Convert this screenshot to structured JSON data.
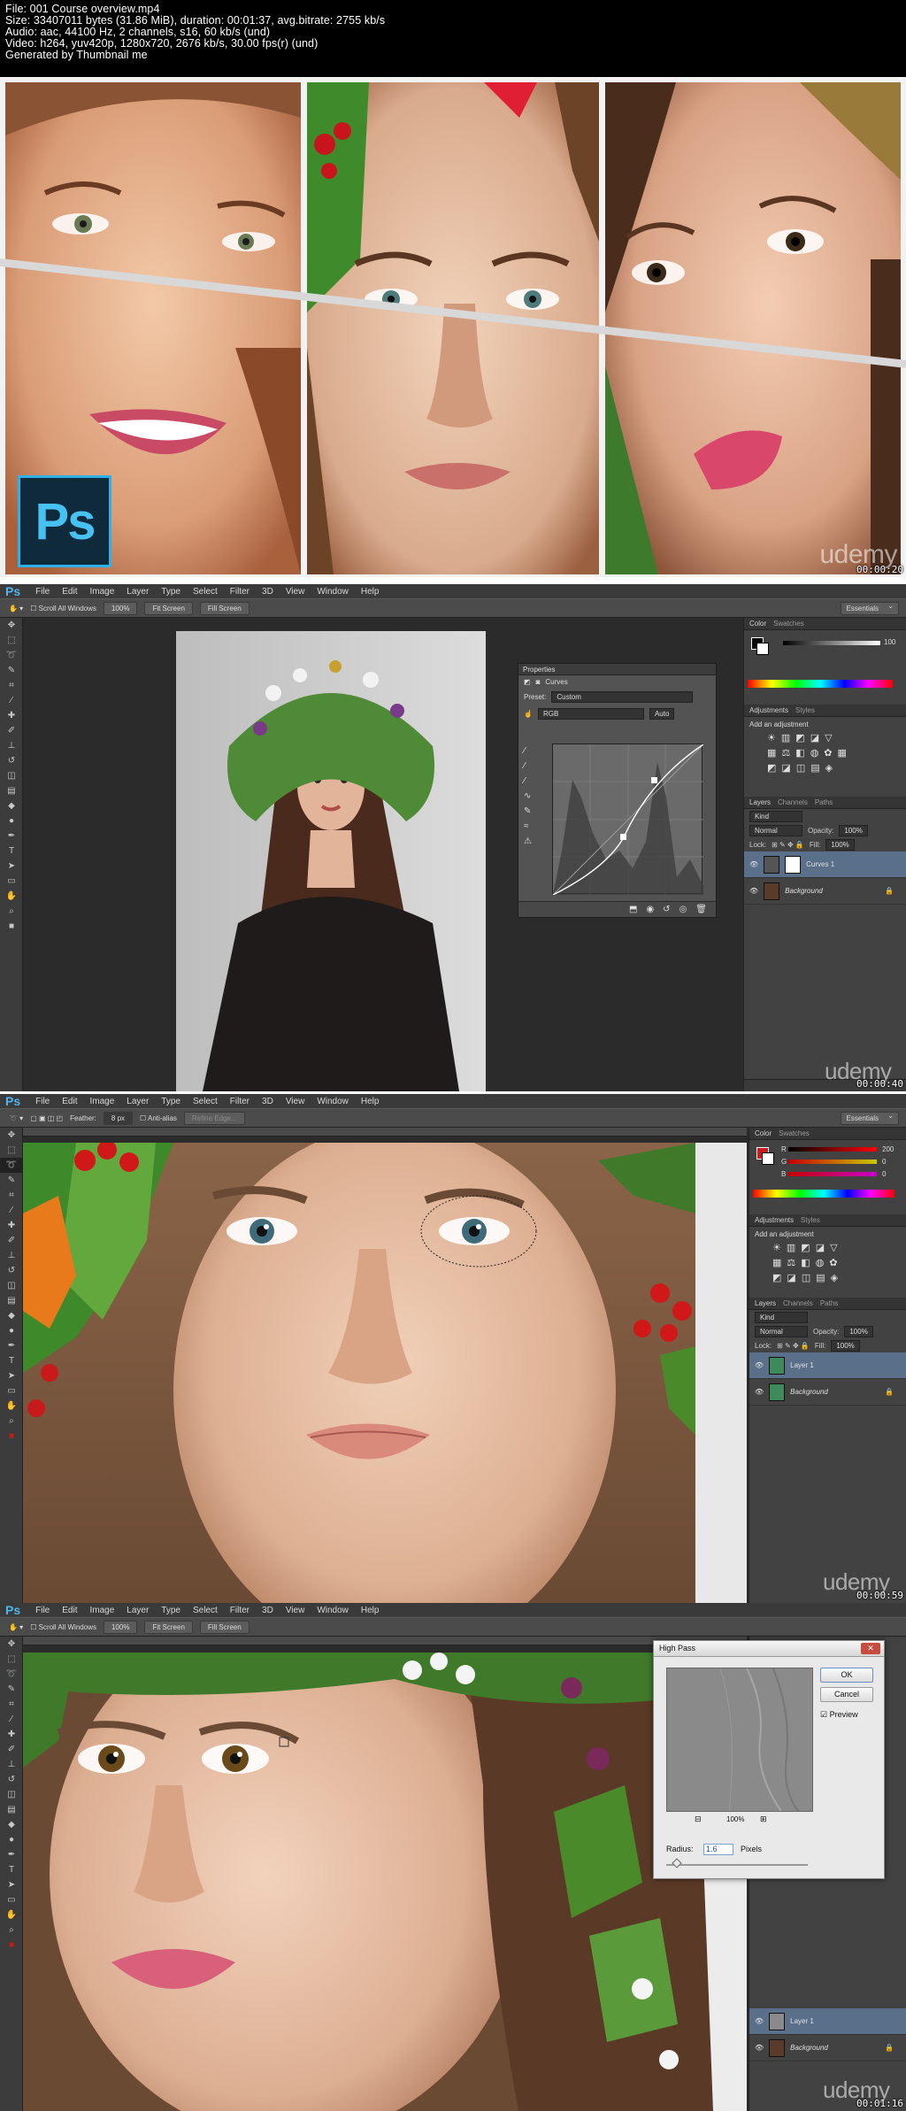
{
  "header": {
    "lines": [
      "File: 001 Course overview.mp4",
      "Size: 33407011 bytes (31.86 MiB), duration: 00:01:37, avg.bitrate: 2755 kb/s",
      "Audio: aac, 44100 Hz, 2 channels, s16, 60 kb/s (und)",
      "Video: h264, yuv420p, 1280x720, 2676 kb/s, 30.00 fps(r) (und)",
      "Generated by Thumbnail me"
    ]
  },
  "watermark": "udemy",
  "ps_logo": "Ps",
  "timestamps": [
    "00:00:20",
    "00:00:40",
    "00:00:59",
    "00:01:16"
  ],
  "menu": {
    "logo": "Ps",
    "items": [
      "File",
      "Edit",
      "Image",
      "Layer",
      "Type",
      "Select",
      "Filter",
      "3D",
      "View",
      "Window",
      "Help"
    ]
  },
  "options_bar": {
    "scroll_all": "Scroll All Windows",
    "zoom_100": "100%",
    "fit_screen": "Fit Screen",
    "fill_screen": "Fill Screen",
    "workspace": "Essentials",
    "feather_label": "Feather:",
    "feather_value": "8 px",
    "anti_alias": "Anti-alias",
    "refine_edge": "Refine Edge..."
  },
  "right_panel": {
    "color_tab": "Color",
    "swatches_tab": "Swatches",
    "adjustments_tab": "Adjustments",
    "styles_tab": "Styles",
    "add_adjustment": "Add an adjustment",
    "layers_tab": "Layers",
    "channels_tab": "Channels",
    "paths_tab": "Paths",
    "kind": "Kind",
    "blend": "Normal",
    "opacity_label": "Opacity:",
    "opacity_value": "100%",
    "lock_label": "Lock:",
    "fill_label": "Fill:",
    "fill_value": "100%",
    "gray_value": "100",
    "rgb_r_label": "R",
    "rgb_g_label": "G",
    "rgb_b_label": "B",
    "rgb_r": "200",
    "rgb_g": "0",
    "rgb_b": "0"
  },
  "layers_p2": [
    {
      "name": "Curves 1",
      "selected": true
    },
    {
      "name": "Background",
      "selected": false
    }
  ],
  "layers_p3": [
    {
      "name": "Layer 1",
      "selected": true
    },
    {
      "name": "Background",
      "selected": false
    }
  ],
  "layers_p4": [
    {
      "name": "Layer 1",
      "selected": true
    },
    {
      "name": "Background",
      "selected": false
    }
  ],
  "properties": {
    "tab": "Properties",
    "title": "Curves",
    "preset_label": "Preset:",
    "preset_value": "Custom",
    "channel": "RGB",
    "auto": "Auto"
  },
  "high_pass": {
    "title": "High Pass",
    "ok": "OK",
    "cancel": "Cancel",
    "preview": "Preview",
    "zoom": "100%",
    "radius_label": "Radius:",
    "radius_value": "1.6",
    "unit": "Pixels"
  }
}
